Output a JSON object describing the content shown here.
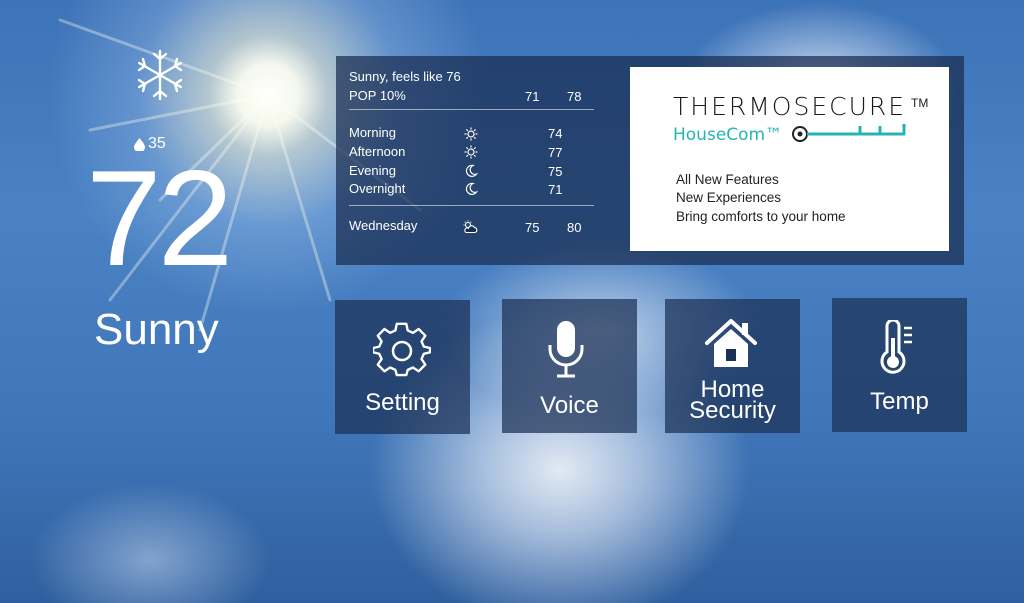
{
  "current": {
    "icon": "snowflake-icon",
    "humidity": "35",
    "temperature": "72",
    "condition": "Sunny"
  },
  "forecast": {
    "summary": "Sunny, feels like 76",
    "pop": "POP 10%",
    "today_low": "71",
    "today_high": "78",
    "periods": [
      {
        "label": "Morning",
        "icon": "sun-icon",
        "temp": "74"
      },
      {
        "label": "Afternoon",
        "icon": "sun-icon",
        "temp": "77"
      },
      {
        "label": "Evening",
        "icon": "moon-icon",
        "temp": "75"
      },
      {
        "label": "Overnight",
        "icon": "moon-icon",
        "temp": "71"
      }
    ],
    "next_day": {
      "label": "Wednesday",
      "icon": "partly-cloudy-icon",
      "low": "75",
      "high": "80"
    }
  },
  "ad": {
    "brand": "THERMOSECURE",
    "trademark": "TM",
    "sub_brand": "HouseCom™",
    "lines": [
      "All New Features",
      "New Experiences",
      "Bring comforts to your home"
    ],
    "accent_color": "#24b5b3"
  },
  "tiles": [
    {
      "label": "Setting",
      "icon": "gear-icon"
    },
    {
      "label": "Voice",
      "icon": "microphone-icon"
    },
    {
      "label_line1": "Home",
      "label_line2": "Security",
      "icon": "home-icon"
    },
    {
      "label": "Temp",
      "icon": "thermometer-icon"
    }
  ]
}
